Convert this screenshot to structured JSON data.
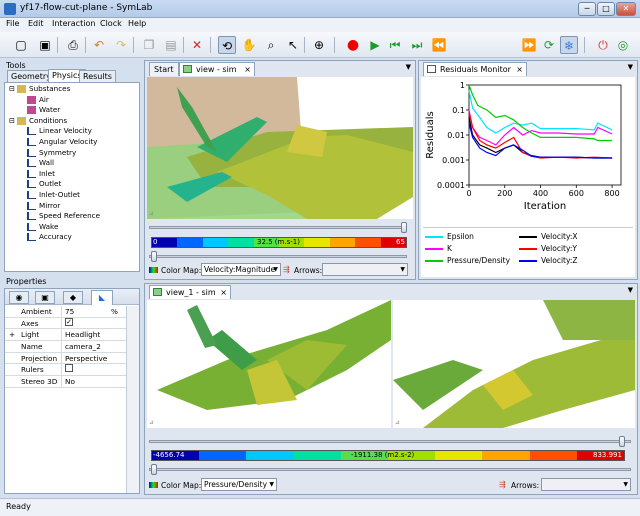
{
  "window": {
    "title": "yf17-flow-cut-plane - SymLab",
    "controls": [
      "─",
      "□",
      "✕"
    ]
  },
  "menu": [
    "File",
    "Edit",
    "Interaction",
    "Clock",
    "Help"
  ],
  "toolbar": {
    "icons": [
      "new-icon",
      "save-icon",
      "print-icon",
      "undo-icon",
      "redo-icon",
      "copy-icon",
      "paste-icon",
      "delete-icon",
      "rotate-icon",
      "pan-icon",
      "zoom-icon",
      "select-icon",
      "zoom-fit-icon",
      "record-icon",
      "play-icon",
      "step-back-icon",
      "step-forward-icon",
      "rewind-icon",
      "fast-forward-icon",
      "loop-icon",
      "freeze-icon",
      "power-icon",
      "target-icon"
    ]
  },
  "tools": {
    "title": "Tools",
    "tabs": [
      "Geometry",
      "Physics",
      "Results"
    ],
    "active_tab": "Physics",
    "tree": [
      {
        "label": "Substances",
        "level": 0,
        "icon": "folder-icon"
      },
      {
        "label": "Air",
        "level": 1,
        "icon": "substance-icon"
      },
      {
        "label": "Water",
        "level": 1,
        "icon": "substance-icon"
      },
      {
        "label": "Conditions",
        "level": 0,
        "icon": "folder-icon"
      },
      {
        "label": "Linear Velocity",
        "level": 1,
        "icon": "arrow-icon"
      },
      {
        "label": "Angular Velocity",
        "level": 1,
        "icon": "curve-icon"
      },
      {
        "label": "Symmetry",
        "level": 1,
        "icon": "symmetry-icon"
      },
      {
        "label": "Wall",
        "level": 1,
        "icon": "wall-icon"
      },
      {
        "label": "Inlet",
        "level": 1,
        "icon": "inlet-icon"
      },
      {
        "label": "Outlet",
        "level": 1,
        "icon": "outlet-icon"
      },
      {
        "label": "Inlet-Outlet",
        "level": 1,
        "icon": "inlet-outlet-icon"
      },
      {
        "label": "Mirror",
        "level": 1,
        "icon": "mirror-icon"
      },
      {
        "label": "Speed Reference",
        "level": 1,
        "icon": "speed-icon"
      },
      {
        "label": "Wake",
        "level": 1,
        "icon": "wake-icon"
      },
      {
        "label": "Accuracy",
        "level": 1,
        "icon": "accuracy-icon"
      }
    ]
  },
  "properties": {
    "title": "Properties",
    "rows": [
      {
        "name": "Ambient",
        "value": "75",
        "unit": "%"
      },
      {
        "name": "Axes",
        "value": "✓",
        "unit": ""
      },
      {
        "name": "Light",
        "value": "Headlight",
        "unit": ""
      },
      {
        "name": "Name",
        "value": "camera_2",
        "unit": ""
      },
      {
        "name": "Projection",
        "value": "Perspective",
        "unit": ""
      },
      {
        "name": "Rulers",
        "value": "",
        "unit": ""
      },
      {
        "name": "Stereo 3D",
        "value": "No",
        "unit": ""
      }
    ]
  },
  "top_view": {
    "tabs": [
      "Start",
      "view - sim"
    ],
    "colorbar": {
      "min": "0",
      "mid": "32.5 (m.s-1)",
      "max": "65"
    },
    "color_map_label": "Color Map:",
    "color_map_value": "Velocity:Magnitude",
    "arrows_label": "Arrows:"
  },
  "residuals": {
    "tab": "Residuals Monitor",
    "ylabel": "Residuals",
    "xlabel": "Iteration",
    "legend": [
      {
        "name": "Epsilon",
        "color": "#00e5ff"
      },
      {
        "name": "Velocity:X",
        "color": "#000000"
      },
      {
        "name": "K",
        "color": "#ff00ff"
      },
      {
        "name": "Velocity:Y",
        "color": "#ff0000"
      },
      {
        "name": "Pressure/Density",
        "color": "#00cc00"
      },
      {
        "name": "Velocity:Z",
        "color": "#0000ff"
      }
    ]
  },
  "bottom_view": {
    "tab": "view_1 - sim",
    "colorbar": {
      "min": "-4656.74",
      "mid": "-1911.38 (m2.s-2)",
      "max": "833.991"
    },
    "color_map_label": "Color Map:",
    "color_map_value": "Pressure/Density",
    "arrows_label": "Arrows:"
  },
  "status": "Ready",
  "chart_data": {
    "type": "line",
    "xlabel": "Iteration",
    "ylabel": "Residuals",
    "xlim": [
      0,
      850
    ],
    "ylim": [
      0.0001,
      1
    ],
    "yscale": "log",
    "x_ticks": [
      "0",
      "200",
      "400",
      "600",
      "800"
    ],
    "y_ticks": [
      "1",
      "0.1",
      "0.01",
      "0.001",
      "0.0001"
    ],
    "legend_position": "bottom",
    "series": [
      {
        "name": "Epsilon",
        "color": "#00e5ff",
        "x": [
          0,
          20,
          60,
          100,
          150,
          200,
          250,
          300,
          350,
          400,
          500,
          600,
          650,
          700,
          720,
          800
        ],
        "y": [
          0.6,
          0.12,
          0.05,
          0.02,
          0.012,
          0.02,
          0.03,
          0.025,
          0.03,
          0.018,
          0.018,
          0.018,
          0.017,
          0.016,
          0.03,
          0.016
        ]
      },
      {
        "name": "K",
        "color": "#ff00ff",
        "x": [
          0,
          20,
          60,
          100,
          150,
          200,
          250,
          300,
          350,
          400,
          500,
          600,
          700,
          720,
          800
        ],
        "y": [
          0.1,
          0.02,
          0.008,
          0.006,
          0.004,
          0.01,
          0.02,
          0.01,
          0.015,
          0.012,
          0.012,
          0.011,
          0.011,
          0.02,
          0.011
        ]
      },
      {
        "name": "Pressure/Density",
        "color": "#00cc00",
        "x": [
          0,
          20,
          50,
          100,
          150,
          200,
          250,
          300,
          350,
          400,
          500,
          600,
          700,
          720,
          800
        ],
        "y": [
          1,
          0.4,
          0.15,
          0.1,
          0.05,
          0.06,
          0.04,
          0.02,
          0.012,
          0.008,
          0.008,
          0.008,
          0.007,
          0.006,
          0.006
        ]
      },
      {
        "name": "Velocity:X",
        "color": "#000000",
        "x": [
          0,
          20,
          60,
          100,
          150,
          200,
          250,
          300,
          350,
          400,
          500,
          600,
          700,
          800
        ],
        "y": [
          0.05,
          0.01,
          0.004,
          0.003,
          0.002,
          0.003,
          0.004,
          0.002,
          0.0015,
          0.0013,
          0.0013,
          0.0013,
          0.0012,
          0.0012
        ]
      },
      {
        "name": "Velocity:Y",
        "color": "#ff0000",
        "x": [
          0,
          20,
          60,
          100,
          150,
          200,
          250,
          300,
          350,
          400,
          500,
          600,
          700,
          800
        ],
        "y": [
          0.08,
          0.02,
          0.006,
          0.004,
          0.003,
          0.005,
          0.008,
          0.002,
          0.0014,
          0.0012,
          0.0013,
          0.0012,
          0.0013,
          0.0012
        ]
      },
      {
        "name": "Velocity:Z",
        "color": "#0000ff",
        "x": [
          0,
          20,
          60,
          100,
          150,
          200,
          250,
          300,
          350,
          400,
          500,
          600,
          700,
          800
        ],
        "y": [
          0.03,
          0.008,
          0.003,
          0.002,
          0.0015,
          0.003,
          0.004,
          0.0025,
          0.0014,
          0.0013,
          0.0013,
          0.0013,
          0.0012,
          0.0012
        ]
      }
    ]
  }
}
